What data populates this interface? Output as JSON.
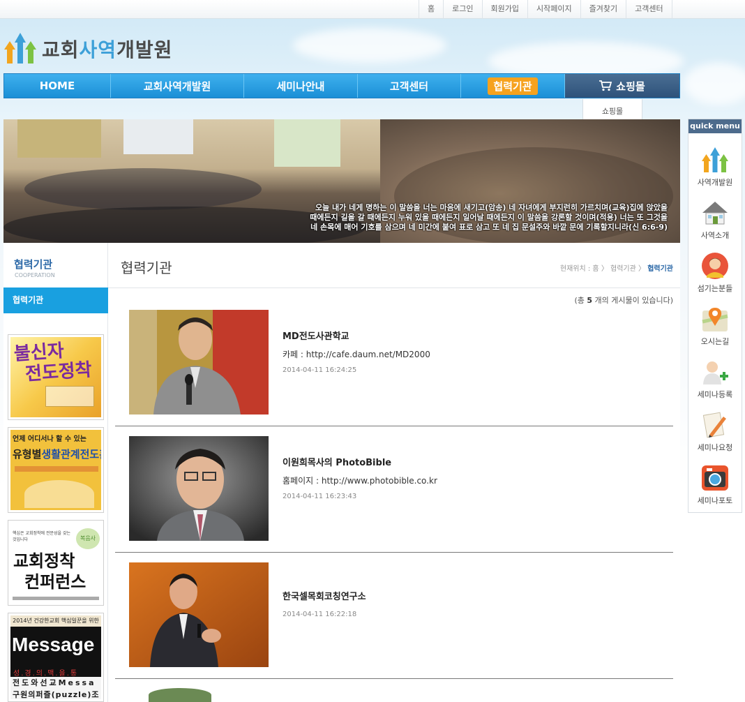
{
  "util_links": [
    "홈",
    "로그인",
    "회원가입",
    "시작페이지",
    "즐겨찾기",
    "고객센터"
  ],
  "logo": {
    "part1": "교회",
    "part2": "사역",
    "part3": "개발원"
  },
  "nav": {
    "home": "HOME",
    "ministry": "교회사역개발원",
    "seminar": "세미나안내",
    "support": "고객센터",
    "partner": "협력기관",
    "shop": "쇼핑몰",
    "shop_sub": "쇼핑몰"
  },
  "banner": {
    "verse_line1": "오늘 내가 네게 명하는 이 말씀을 너는 마음에 새기고(암송) 네 자녀에게 부지런히 가르치며(교육)집에 앉았을",
    "verse_line2": "때에든지 길을 갈 때에든지 누워 있을 때에든지 일어날 때에든지 이 말씀을 강론할 것이며(적용) 너는 또 그것을",
    "verse_line3": "네 손목에 매어 기호를 삼으며 네 미간에 붙여 표로 삼고 또 네 집 문설주와 바깥 문에 기록할지니라(신 6:6-9)"
  },
  "sidebar": {
    "title": "협력기관",
    "subtitle": "COOPERATION",
    "menu_item": "협력기관",
    "ads": [
      {
        "text1": "불신자",
        "text2": "전도정착"
      },
      {
        "top": "언제 어디서나 할 수 있는",
        "main1": "유형별",
        "main2": "생활관계전도훈련"
      },
      {
        "top": "핵심은 교회정착에 전문성을 갖는 것입니다",
        "main1": "교회정착",
        "main2": "컨퍼런스",
        "badge": "복음사"
      },
      {
        "top": "2014년 건강한교회 핵심일꾼을 위한",
        "main": "Message",
        "line2": "성.경.의.맥.을.통",
        "line3": "전도와선교Messa",
        "line4": "구원의퍼즐(puzzle)조"
      }
    ]
  },
  "content": {
    "page_title": "협력기관",
    "breadcrumb_label": "현재위치 : ",
    "breadcrumb": [
      "홈",
      "협력기관",
      "협력기관"
    ],
    "count_prefix": "(총 ",
    "count": "5",
    "count_suffix": " 개의 게시물이 있습니다)",
    "posts": [
      {
        "title": "MD전도사관학교",
        "link": "카페 : http://cafe.daum.net/MD2000",
        "date": "2014-04-11 16:24:25"
      },
      {
        "title": "이원희목사의 PhotoBible",
        "link": "홈페이지 : http://www.photobible.co.kr",
        "date": "2014-04-11 16:23:43"
      },
      {
        "title": "한국셀목회코칭연구소",
        "link": "",
        "date": "2014-04-11 16:22:18"
      }
    ]
  },
  "quick_menu": {
    "title": "quick menu",
    "items": [
      "사역개발원",
      "사역소개",
      "섬기는분들",
      "오시는길",
      "세미나등록",
      "세미나요청",
      "세미나포토"
    ]
  },
  "colors": {
    "nav_blue": "#1a8fd6",
    "nav_shop": "#2e527a",
    "accent_orange": "#f6a21e",
    "side_menu": "#19a0e0",
    "title_blue": "#2e6aa8"
  }
}
